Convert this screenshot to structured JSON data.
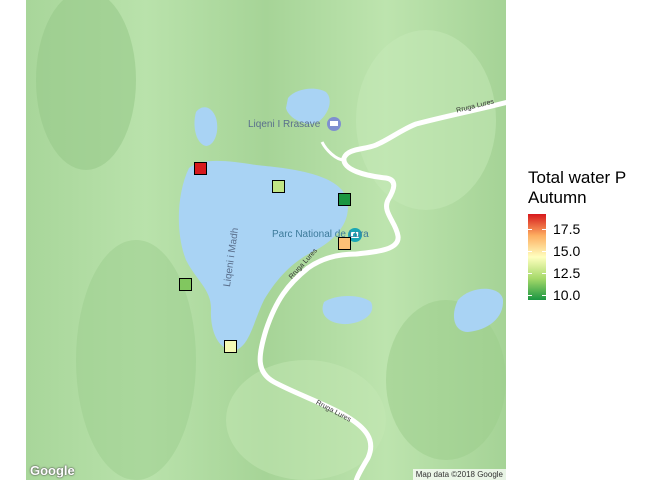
{
  "map": {
    "labels": {
      "lake_upper": "Liqeni I Rrasave",
      "lake_main": "Liqeni i Madh",
      "park": "Parc National de Lura",
      "road_top": "Rruga Lures",
      "road_mid": "Rruga Lures",
      "road_bottom": "Rruga Lures"
    },
    "google_logo": "Google",
    "attribution": "Map data ©2018 Google",
    "icons": [
      "lodging-pin-icon",
      "camera-pin-icon"
    ]
  },
  "legend": {
    "title_line1": "Total water P",
    "title_line2": "Autumn",
    "ticks": [
      "17.5",
      "15.0",
      "12.5",
      "10.0"
    ],
    "scale_min": 9.4,
    "scale_max": 19.2,
    "colors": {
      "low": "#1a9641",
      "mid_low": "#a6d96a",
      "mid": "#ffffbf",
      "mid_high": "#fdae61",
      "high": "#d7191c"
    }
  },
  "chart_data": {
    "type": "scatter",
    "title": "",
    "legend_title": "Total water P Autumn",
    "points": [
      {
        "site": 1,
        "value": 19.2
      },
      {
        "site": 2,
        "value": 12.6
      },
      {
        "site": 3,
        "value": 9.4
      },
      {
        "site": 4,
        "value": 16.2
      },
      {
        "site": 5,
        "value": 11.2
      },
      {
        "site": 6,
        "value": 14.0
      }
    ]
  }
}
